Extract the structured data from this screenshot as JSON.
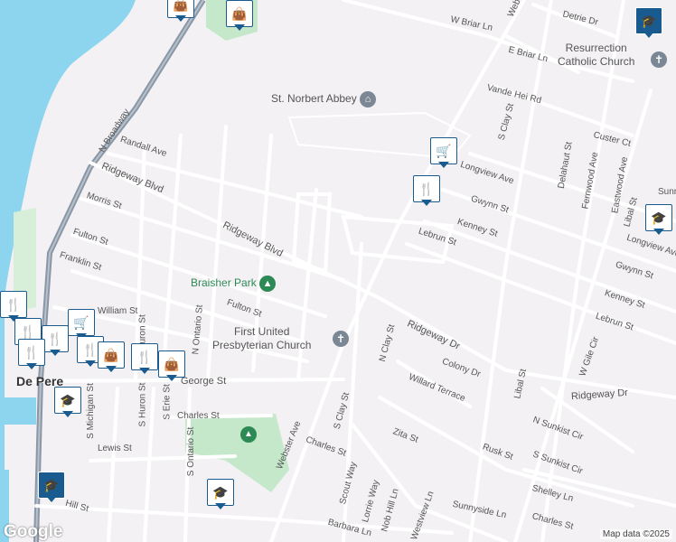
{
  "map": {
    "town": "De Pere",
    "attribution": "Map data ©2025",
    "logo": "Google",
    "colors": {
      "water": "#8dd5ef",
      "park": "#c5e8cb",
      "road": "#ffffff",
      "highway": "#8a97a6",
      "background": "#f3f1f4",
      "pin": "#1a5b8f"
    }
  },
  "streets": {
    "w_briar_ln": "W Briar Ln",
    "e_briar_ln": "E Briar Ln",
    "detrie_dr": "Detrie Dr",
    "vande_hei_rd": "Vande Hei Rd",
    "s_clay_st_n": "S Clay St",
    "custer_ct": "Custer Ct",
    "longview_ave": "Longview Ave",
    "longview_ave_e": "Longview Ave",
    "gwynn_st": "Gwynn St",
    "gwynn_st_e": "Gwynn St",
    "kenney_st": "Kenney St",
    "kenney_st_e": "Kenney St",
    "lebrun_st": "Lebrun St",
    "lebrun_st_e": "Lebrun St",
    "delahaut_st": "Delahaut St",
    "fernwood_ave": "Fernwood Ave",
    "eastwood_ave": "Eastwood Ave",
    "libal_st_n": "Libal St",
    "libal_st_s": "Libal St",
    "sunr": "Sunr",
    "n_broadway": "N Broadway",
    "randall_ave": "Randall Ave",
    "ridgeway_blvd_w": "Ridgeway Blvd",
    "ridgeway_blvd": "Ridgeway Blvd",
    "morris_st": "Morris St",
    "fulton_st_w": "Fulton St",
    "fulton_st": "Fulton St",
    "franklin_st": "Franklin St",
    "william_st": "William St",
    "n_clay_st": "N Clay St",
    "ridgeway_dr": "Ridgeway Dr",
    "ridgeway_dr_e": "Ridgeway Dr",
    "colony_dr": "Colony Dr",
    "willard_terrace": "Willard Terrace",
    "w_gile_cir": "W Gile Cir",
    "n_sunkist_cir": "N Sunkist Cir",
    "s_sunkist_cir": "S Sunkist Cir",
    "shelley_ln": "Shelley Ln",
    "charles_st_e": "Charles St",
    "zita_st": "Zita St",
    "rusk_st": "Rusk St",
    "webster_ave": "Webster Ave",
    "s_clay_st": "S Clay St",
    "charles_st_mid": "Charles St",
    "charles_st_w": "Charles St",
    "george_st": "George St",
    "n_ontario_st": "N Ontario St",
    "n_huron_st": "N Huron St",
    "s_michigan_st": "S Michigan St",
    "s_huron_st": "S Huron St",
    "s_erie_st": "S Erie St",
    "s_ontario_st": "S Ontario St",
    "lewis_st": "Lewis St",
    "scout_way": "Scout Way",
    "lorrie_way": "Lorrie Way",
    "nob_hill_ln": "Nob Hill Ln",
    "westview_ln": "Westview Ln",
    "barbara_ln": "Barbara Ln",
    "sunnyside_ln": "Sunnyside Ln",
    "hill_st": "Hill St",
    "webs": "Webs"
  },
  "pois": {
    "st_norbert_abbey": "St. Norbert Abbey",
    "resurrection_line1": "Resurrection",
    "resurrection_line2": "Catholic Church",
    "braisher_park": "Braisher Park",
    "first_united_line1": "First United",
    "first_united_line2": "Presbyterian Church"
  },
  "markers": [
    {
      "icon": "school-icon"
    },
    {
      "icon": "shopping-bag-icon"
    },
    {
      "icon": "grocery-cart-icon"
    },
    {
      "icon": "restaurant-icon"
    },
    {
      "icon": "school-icon"
    },
    {
      "icon": "school-icon"
    },
    {
      "icon": "school-icon"
    },
    {
      "icon": "shopping-bag-icon"
    },
    {
      "icon": "restaurant-icon"
    }
  ]
}
